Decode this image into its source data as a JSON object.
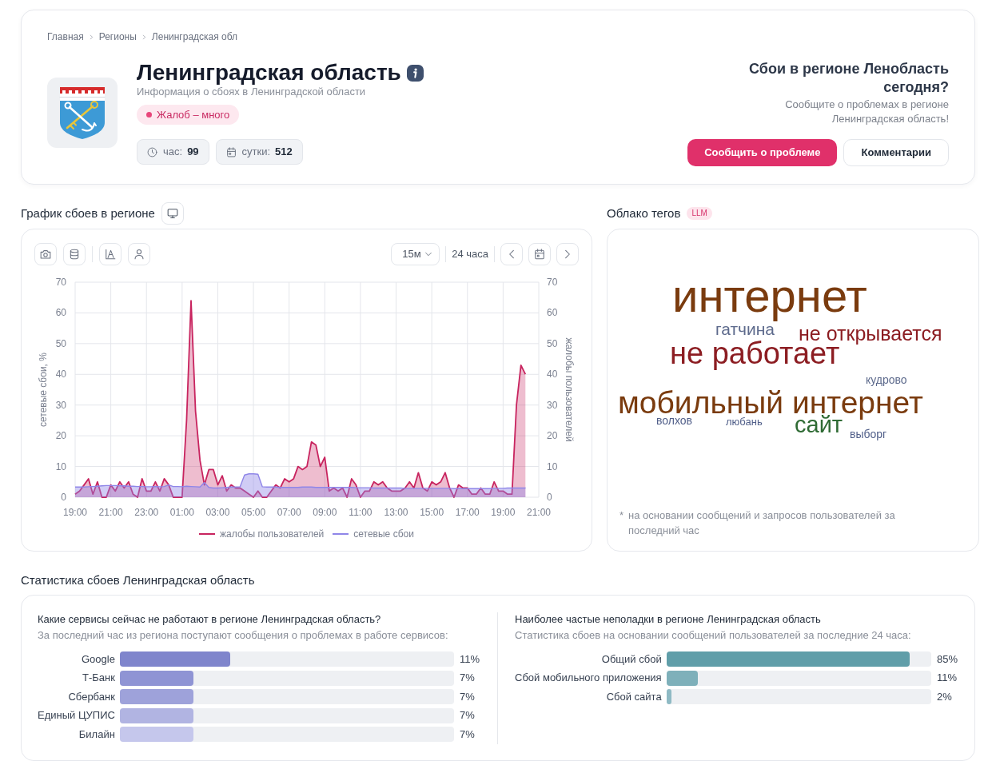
{
  "breadcrumbs": [
    {
      "label": "Главная"
    },
    {
      "label": "Регионы"
    },
    {
      "label": "Ленинградская обл"
    }
  ],
  "header": {
    "title": "Ленинградская область",
    "subtitle": "Информация о сбоях в Ленинградской области",
    "status": {
      "kind": "high",
      "label": "Жалоб – много"
    },
    "counters": [
      {
        "kind": "hour",
        "label": "час:",
        "value": "99"
      },
      {
        "kind": "day",
        "label": "сутки:",
        "value": "512"
      }
    ]
  },
  "report": {
    "heading": "Сбои в регионе Ленобласть сегодня?",
    "text": "Сообщите о проблемах в регионе Ленинградская область!",
    "buttons": [
      {
        "kind": "primary",
        "label": "Сообщить о проблеме"
      },
      {
        "kind": "secondary",
        "label": "Комментарии"
      }
    ]
  },
  "chart_section": {
    "title": "График сбоев в регионе",
    "toolbar": {
      "interval": {
        "value": "15м"
      },
      "range": "24 часа"
    },
    "right_yticks": [
      "70",
      "60",
      "50",
      "40",
      "30",
      "20",
      "10",
      "0"
    ],
    "chart_data": {
      "type": "area",
      "grid": true,
      "legend": "bottom",
      "ylabel": "сетевые сбои, %",
      "y2label": "жалобы пользователей",
      "categories": [
        "19:00",
        null,
        null,
        null,
        null,
        null,
        null,
        null,
        "21:00",
        null,
        null,
        null,
        null,
        null,
        null,
        null,
        "23:00",
        null,
        null,
        null,
        null,
        null,
        null,
        null,
        "01:00",
        null,
        null,
        null,
        null,
        null,
        null,
        null,
        "03:00",
        null,
        null,
        null,
        null,
        null,
        null,
        null,
        "05:00",
        null,
        null,
        null,
        null,
        null,
        null,
        null,
        "07:00",
        null,
        null,
        null,
        null,
        null,
        null,
        null,
        "09:00",
        null,
        null,
        null,
        null,
        null,
        null,
        null,
        "11:00",
        null,
        null,
        null,
        null,
        null,
        null,
        null,
        "13:00",
        null,
        null,
        null,
        null,
        null,
        null,
        null,
        "15:00",
        null,
        null,
        null,
        null,
        null,
        null,
        null,
        "17:00",
        null,
        null,
        null,
        null,
        null,
        null,
        null,
        "19:00",
        null,
        null,
        null,
        null,
        null,
        null,
        null,
        "21:00"
      ],
      "series": [
        {
          "name": "жалобы пользователей",
          "color": "#c8245f",
          "values": [
            1,
            2,
            4,
            6,
            1,
            5,
            0,
            0,
            4,
            2,
            5,
            3,
            5,
            1,
            0,
            6,
            2,
            2,
            5,
            2,
            6,
            4,
            0,
            0,
            0,
            25,
            64,
            28,
            12,
            4,
            9,
            9,
            4,
            7,
            2,
            4,
            3,
            3,
            2,
            1,
            0,
            2,
            0,
            0,
            2,
            4,
            3,
            6,
            5,
            6,
            10,
            9,
            10,
            18,
            17,
            10,
            13,
            2,
            3,
            2,
            3,
            0,
            6,
            4,
            0,
            2,
            2,
            5,
            4,
            5,
            3,
            2,
            2,
            2,
            3,
            5,
            3,
            8,
            3,
            2,
            5,
            4,
            5,
            8,
            3,
            0,
            4,
            3,
            3,
            1,
            1,
            3,
            1,
            1,
            5,
            2,
            2,
            1,
            1,
            30,
            43,
            40,
            null,
            null,
            null
          ]
        },
        {
          "name": "сетевые сбои",
          "color": "#8f86e8",
          "values": [
            3.3,
            3.3,
            3.3,
            3.4,
            3.5,
            3.6,
            3.7,
            3.8,
            3.8,
            3.8,
            3.7,
            3.7,
            3.6,
            3.6,
            3.5,
            3.5,
            3.4,
            3.4,
            3.5,
            3.4,
            3.5,
            4,
            3.5,
            3.5,
            3.4,
            3.6,
            3.5,
            3.4,
            3.3,
            4.8,
            3.2,
            3,
            3,
            3.1,
            3.2,
            3.3,
            3.3,
            3.4,
            7.2,
            7.6,
            7.6,
            7.5,
            3.4,
            3.3,
            3.3,
            3.3,
            3.2,
            3.2,
            3.2,
            3.2,
            3.2,
            3.3,
            3.3,
            3.3,
            3.2,
            3.2,
            3.2,
            3.2,
            3.2,
            3.2,
            3.2,
            3.2,
            3.2,
            3.1,
            3.1,
            3.1,
            3.1,
            3,
            3,
            3,
            3,
            3,
            3,
            3,
            2.9,
            2.9,
            2.9,
            2.9,
            2.9,
            2.9,
            2.9,
            2.9,
            2.9,
            2.9,
            2.9,
            2.8,
            2.8,
            2.8,
            2.8,
            2.8,
            2.8,
            2.8,
            2.8,
            2.8,
            2.9,
            2.9,
            2.9,
            3,
            3,
            3,
            3,
            3,
            null,
            null,
            null
          ]
        }
      ],
      "ylim": [
        0,
        70
      ],
      "yticks": [
        {
          "value": 0,
          "label": "0"
        },
        {
          "value": 10,
          "label": "10"
        },
        {
          "value": 20,
          "label": "20"
        },
        {
          "value": 30,
          "label": "30"
        },
        {
          "value": 40,
          "label": "40"
        },
        {
          "value": 50,
          "label": "50"
        },
        {
          "value": 60,
          "label": "60"
        },
        {
          "value": 70,
          "label": "70"
        }
      ]
    }
  },
  "tag_cloud": {
    "title": "Облако тегов",
    "badge": "LLM",
    "tags": [
      {
        "text": "интернет",
        "color": "#7a3b0e"
      },
      {
        "text": "гатчина",
        "color": "#5d6a8c"
      },
      {
        "text": "не открывается",
        "color": "#8c1d22"
      },
      {
        "text": "не работает",
        "color": "#8c1d22"
      },
      {
        "text": "кудрово",
        "color": "#5d6a8c"
      },
      {
        "text": "мобильный интернет",
        "color": "#7a3b0e"
      },
      {
        "text": "волхов",
        "color": "#52608a"
      },
      {
        "text": "любань",
        "color": "#52608a"
      },
      {
        "text": "сайт",
        "color": "#2f6b34"
      },
      {
        "text": "выборг",
        "color": "#52608a"
      }
    ],
    "footnote_mark": "*",
    "footnote": "на основании сообщений и запросов пользователей за последний час"
  },
  "stats": {
    "title": "Статистика сбоев Ленинградская область",
    "blocks": [
      {
        "heading": "Какие сервисы сейчас не работают в регионе Ленинградская область?",
        "subheading": "За последний час из региона поступают сообщения о проблемах в работе сервисов:",
        "rows": [
          {
            "label": "Google",
            "level": 0.33,
            "value": "11%",
            "color": "#7f85cc"
          },
          {
            "label": "Т-Банк",
            "level": 0.22,
            "value": "7%",
            "color": "#8f94d4"
          },
          {
            "label": "Сбербанк",
            "level": 0.22,
            "value": "7%",
            "color": "#9ea2da"
          },
          {
            "label": "Единый ЦУПИС",
            "level": 0.22,
            "value": "7%",
            "color": "#b1b4e2"
          },
          {
            "label": "Билайн",
            "level": 0.22,
            "value": "7%",
            "color": "#c5c7ec"
          }
        ]
      },
      {
        "heading": "Наиболее частые неполадки в регионе Ленинградская область",
        "subheading": "Статистика сбоев на основании сообщений пользователей за последние 24 часа:",
        "rows": [
          {
            "label": "Общий сбой",
            "level": 0.92,
            "value": "85%",
            "color": "#609ea9"
          },
          {
            "label": "Сбой мобильного приложения",
            "level": 0.12,
            "value": "11%",
            "color": "#7eb0ba"
          },
          {
            "label": "Сбой сайта",
            "level": 0.02,
            "value": "2%",
            "color": "#8fbac4"
          }
        ]
      }
    ]
  }
}
